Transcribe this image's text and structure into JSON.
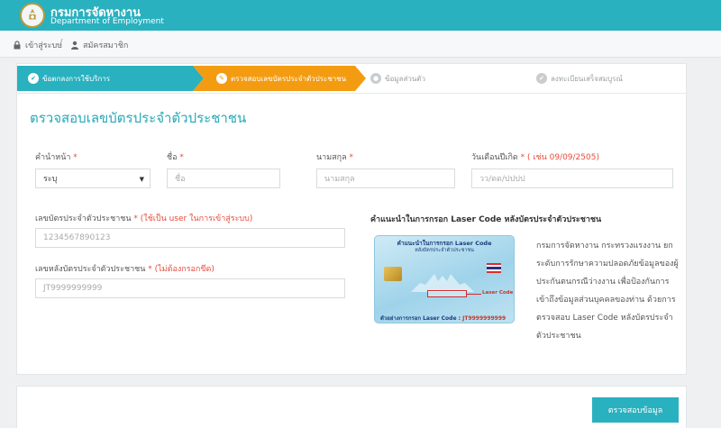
{
  "header": {
    "brand_th": "กรมการจัดหางาน",
    "brand_en": "Department of Employment"
  },
  "breadcrumb": {
    "login": "เข้าสู่ระบบ",
    "register": "สมัครสมาชิก"
  },
  "steps": [
    {
      "label": "ข้อตกลงการใช้บริการ",
      "state": "done"
    },
    {
      "label": "ตรวจสอบเลขบัตรประจำตัวประชาชน",
      "state": "active"
    },
    {
      "label": "ข้อมูลส่วนตัว",
      "state": "pending"
    },
    {
      "label": "ลงทะเบียนเสร็จสมบูรณ์",
      "state": "pending"
    }
  ],
  "form": {
    "title": "ตรวจสอบเลขบัตรประจำตัวประชาชน",
    "prefix": {
      "label": "คำนำหน้า",
      "req": "*",
      "value": "ระบุ"
    },
    "firstname": {
      "label": "ชื่อ",
      "req": "*",
      "placeholder": "ชื่อ"
    },
    "lastname": {
      "label": "นามสกุล",
      "req": "*",
      "placeholder": "นามสกุล"
    },
    "birthdate": {
      "label": "วันเดือนปีเกิด",
      "req": "* ( เช่น 09/09/2505)",
      "placeholder": "วว/ดด/ปปปป"
    },
    "idnumber": {
      "label": "เลขบัตรประจำตัวประชาชน",
      "req": "* (ใช้เป็น user ในการเข้าสู่ระบบ)",
      "placeholder": "1234567890123"
    },
    "laser": {
      "label": "เลขหลังบัตรประจำตัวประชาชน",
      "req": "* (ไม่ต้องกรอกขีด)",
      "placeholder": "JT9999999999"
    }
  },
  "hint": {
    "title": "คำแนะนำในการกรอก Laser Code หลังบัตรประจำตัวประชาชน",
    "card_title": "คำแนะนำในการกรอก Laser Code",
    "card_subtitle": "หลังบัตรประจำตัวประชาชน",
    "card_laser_label": "Laser Code",
    "card_example": "ตัวอย่างการกรอก Laser Code :",
    "card_example_code": "JT9999999999",
    "text": "กรมการจัดหางาน กระทรวงแรงงาน ยกระดับการรักษาความปลอดภัยข้อมูลของผู้ประกันตนกรณีว่างงาน เพื่อป้องกันการเข้าถึงข้อมูลส่วนบุคคลของท่าน ด้วยการตรวจสอบ Laser Code หลังบัตรประจำตัวประชาชน"
  },
  "footer": {
    "submit_label": "ตรวจสอบข้อมูล"
  },
  "colors": {
    "brand": "#29b1bf",
    "active_step": "#f39c12",
    "required": "#e74c3c"
  }
}
